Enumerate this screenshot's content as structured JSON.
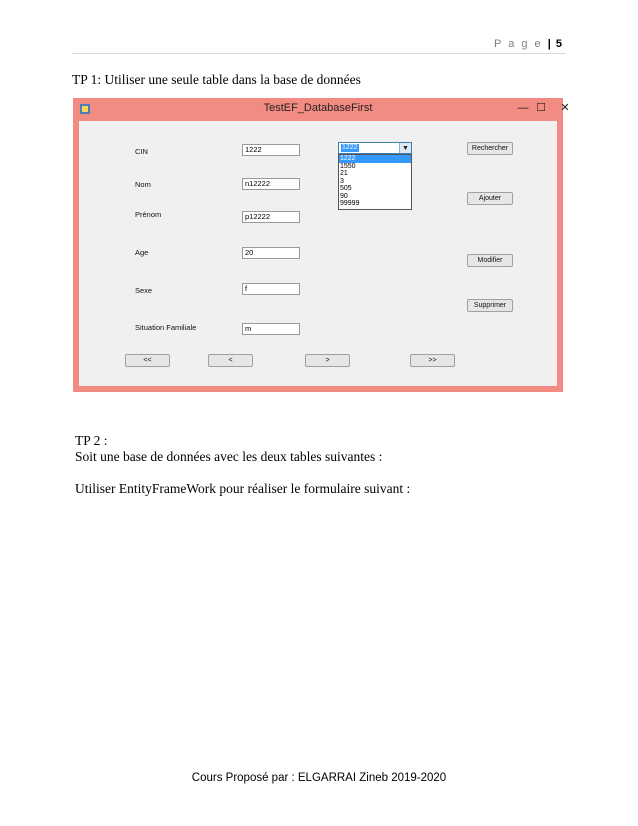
{
  "header": {
    "page_word": "P a g e",
    "separator": "|",
    "page_number": "5"
  },
  "tp1_heading": "TP 1: Utiliser une seule table dans la base de données",
  "window": {
    "title": "TestEF_DatabaseFirst",
    "controls": {
      "minimize": "—",
      "maximize": "☐",
      "close": "✕"
    },
    "labels": {
      "cin": "CIN",
      "nom": "Nom",
      "prenom": "Prénom",
      "age": "Age",
      "sexe": "Sexe",
      "situation": "Situation Familiale"
    },
    "values": {
      "cin": "1222",
      "nom": "n12222",
      "prenom": "p12222",
      "age": "20",
      "sexe": "f",
      "situation": "m"
    },
    "combo": {
      "selected": "1222",
      "options": [
        "1222",
        "1550",
        "21",
        "3",
        "505",
        "90",
        "99999"
      ]
    },
    "buttons": {
      "rechercher": "Rechercher",
      "ajouter": "Ajouter",
      "modifier": "Modifier",
      "supprimer": "Supprimer",
      "first": "<<",
      "prev": "<",
      "next": ">",
      "last": ">>"
    },
    "colors": {
      "title_bar": "#f28b82",
      "selection": "#3399ff"
    }
  },
  "tp2": {
    "heading": "TP 2 :",
    "subtitle": "Soit une base de données avec les deux tables suivantes :",
    "instruction": "Utiliser EntityFrameWork pour réaliser le formulaire suivant :"
  },
  "footer": "Cours Proposé  par : ELGARRAI Zineb  2019-2020"
}
